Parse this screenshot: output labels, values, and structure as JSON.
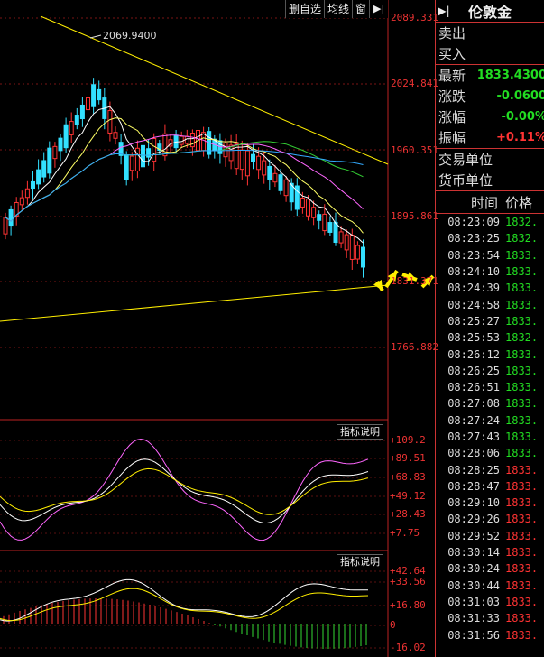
{
  "toolbar": {
    "delete_watch": "删自选",
    "ma_line": "均线",
    "window": "窗"
  },
  "price_axis": [
    "2089.331",
    "2024.841",
    "1960.351",
    "1895.861",
    "1831.371",
    "1766.882"
  ],
  "high_marker": "2069.9400",
  "indicator1": {
    "label": "指标说明",
    "ticks": [
      "+109.2",
      "+89.51",
      "+68.83",
      "+49.12",
      "+28.43",
      "+7.75"
    ]
  },
  "indicator2": {
    "label": "指标说明",
    "ticks": [
      "+42.64",
      "+33.56",
      "+16.80",
      "0",
      "-16.02"
    ]
  },
  "colors": {
    "up": "#ff3333",
    "down": "#33e0ff",
    "axis_text": "#ff3333",
    "price_green": "#22dd22",
    "price_red": "#ff3333",
    "annotation": "#ffee00"
  },
  "side": {
    "title": "伦敦金",
    "sell_label": "卖出",
    "buy_label": "买入",
    "latest_label": "最新",
    "latest_value": "1833.4300",
    "change_label": "涨跌",
    "change_value": "-0.0600",
    "change_pct_label": "涨幅",
    "change_pct_value": "-0.00%",
    "amplitude_label": "振幅",
    "amplitude_value": "+0.11%",
    "trade_unit_label": "交易单位",
    "currency_unit_label": "货币单位",
    "time_header": "时间",
    "price_header": "价格"
  },
  "ticks": [
    {
      "time": "08:23:09",
      "price": "1832."
    },
    {
      "time": "08:23:25",
      "price": "1832."
    },
    {
      "time": "08:23:54",
      "price": "1833."
    },
    {
      "time": "08:24:10",
      "price": "1833."
    },
    {
      "time": "08:24:39",
      "price": "1833."
    },
    {
      "time": "08:24:58",
      "price": "1833."
    },
    {
      "time": "08:25:27",
      "price": "1833."
    },
    {
      "time": "08:25:53",
      "price": "1832."
    },
    {
      "time": "08:26:12",
      "price": "1833."
    },
    {
      "time": "08:26:25",
      "price": "1833."
    },
    {
      "time": "08:26:51",
      "price": "1833."
    },
    {
      "time": "08:27:08",
      "price": "1833."
    },
    {
      "time": "08:27:24",
      "price": "1833."
    },
    {
      "time": "08:27:43",
      "price": "1833."
    },
    {
      "time": "08:28:06",
      "price": "1833."
    },
    {
      "time": "08:28:25",
      "price": "1833."
    },
    {
      "time": "08:28:47",
      "price": "1833."
    },
    {
      "time": "08:29:10",
      "price": "1833."
    },
    {
      "time": "08:29:26",
      "price": "1833."
    },
    {
      "time": "08:29:52",
      "price": "1833."
    },
    {
      "time": "08:30:14",
      "price": "1833."
    },
    {
      "time": "08:30:24",
      "price": "1833."
    },
    {
      "time": "08:30:44",
      "price": "1833."
    },
    {
      "time": "08:31:03",
      "price": "1833."
    },
    {
      "time": "08:31:33",
      "price": "1833."
    },
    {
      "time": "08:31:56",
      "price": "1833."
    }
  ],
  "tick_colors": [
    "green",
    "green",
    "green",
    "green",
    "green",
    "green",
    "green",
    "green",
    "green",
    "green",
    "green",
    "green",
    "green",
    "green",
    "green",
    "red",
    "red",
    "red",
    "red",
    "red",
    "red",
    "red",
    "red",
    "red",
    "red",
    "red"
  ]
}
